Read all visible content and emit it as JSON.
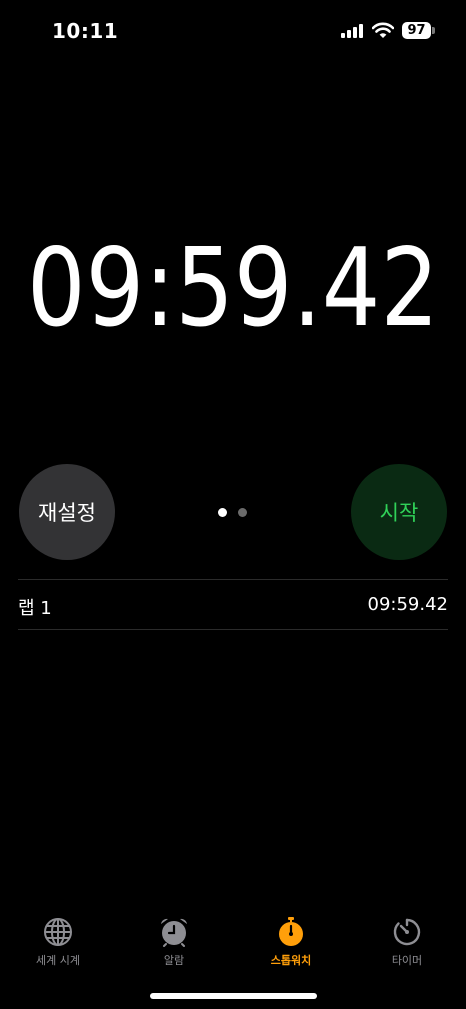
{
  "status": {
    "time": "10:11",
    "battery": "97"
  },
  "stopwatch": {
    "display": "09:59.42"
  },
  "controls": {
    "reset_label": "재설정",
    "start_label": "시작"
  },
  "laps": [
    {
      "label": "랩 1",
      "time": "09:59.42"
    }
  ],
  "tabs": [
    {
      "label": "세계 시계",
      "icon": "globe-icon",
      "active": false
    },
    {
      "label": "알람",
      "icon": "alarm-clock-icon",
      "active": false
    },
    {
      "label": "스톱워치",
      "icon": "stopwatch-icon",
      "active": true
    },
    {
      "label": "타이머",
      "icon": "timer-icon",
      "active": false
    }
  ],
  "colors": {
    "accent": "#ff9f0a",
    "start_text": "#30d158",
    "start_bg": "#0a2a13",
    "reset_bg": "#333335"
  }
}
